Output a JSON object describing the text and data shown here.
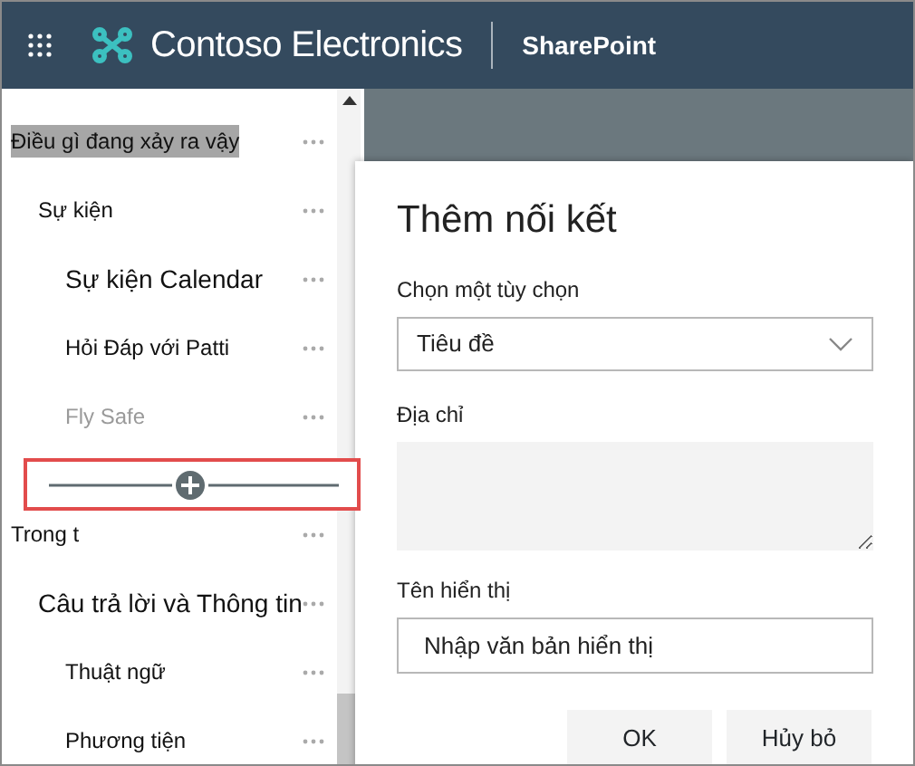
{
  "header": {
    "brand": "Contoso Electronics",
    "app": "SharePoint"
  },
  "nav": [
    {
      "label": "Điều gì đang xảy ra vậy",
      "selected": true,
      "disabled": false,
      "children": [
        {
          "label": "Sự kiện",
          "selected": false,
          "disabled": false,
          "children": [
            {
              "label": "Sự kiện Calendar",
              "selected": false,
              "disabled": false
            },
            {
              "label": "Hỏi Đáp với Patti",
              "selected": false,
              "disabled": false
            },
            {
              "label": "Fly Safe",
              "selected": false,
              "disabled": true
            }
          ]
        }
      ]
    },
    {
      "label": "Trong t",
      "selected": false,
      "disabled": false,
      "children": [
        {
          "label": "Câu trả lời và Thông tin",
          "selected": false,
          "disabled": false,
          "children": [
            {
              "label": "Thuật ngữ",
              "selected": false,
              "disabled": false
            },
            {
              "label": "Phương tiện",
              "selected": false,
              "disabled": false
            }
          ]
        }
      ]
    }
  ],
  "dialog": {
    "title": "Thêm nối kết",
    "fields": [
      {
        "kind": "select",
        "label": "Chọn một tùy chọn",
        "value": "Tiêu đề"
      },
      {
        "kind": "textarea",
        "label": "Địa chỉ"
      },
      {
        "kind": "input",
        "label": "Tên hiển thị",
        "placeholder": "Nhập văn bản hiển thị"
      }
    ],
    "buttons": [
      "OK",
      "Hủy bỏ"
    ]
  }
}
